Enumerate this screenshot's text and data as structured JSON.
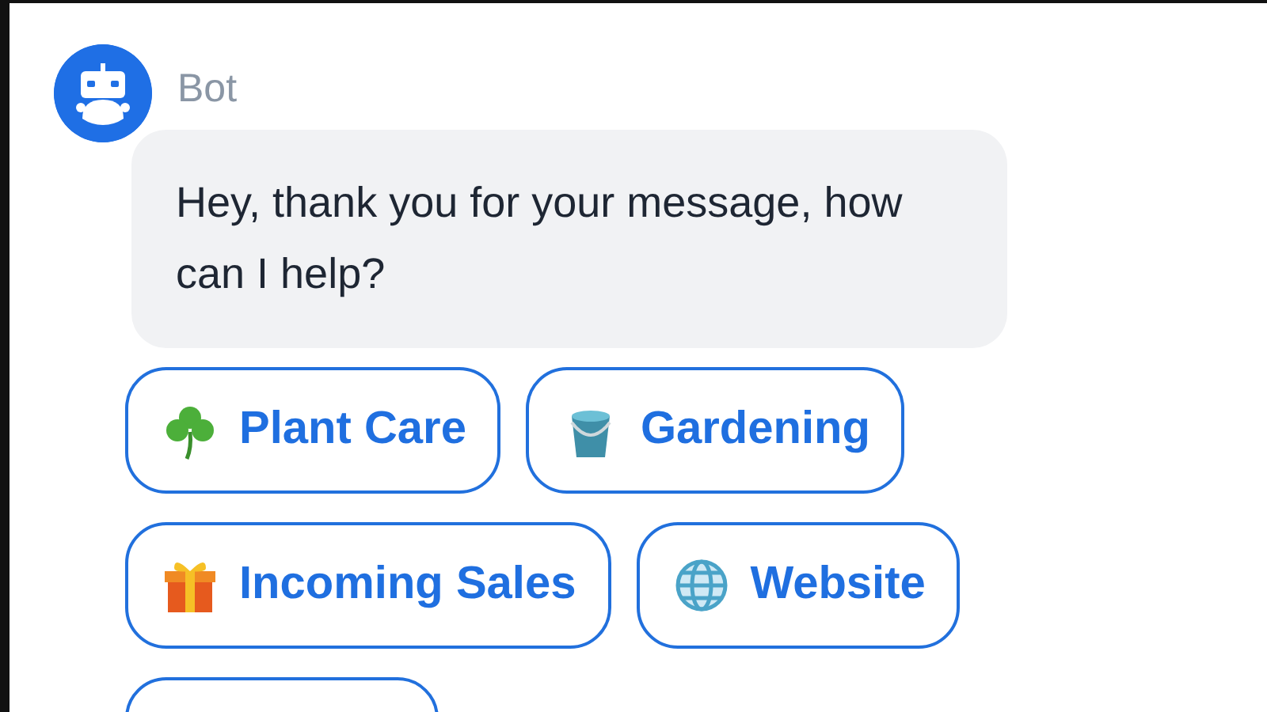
{
  "sender": {
    "name": "Bot"
  },
  "message": {
    "text": "Hey, thank you for your message, how can I help?"
  },
  "quick_replies": [
    {
      "kind": "clover",
      "label": "Plant Care"
    },
    {
      "kind": "bucket",
      "label": "Gardening"
    },
    {
      "kind": "gift",
      "label": "Incoming Sales"
    },
    {
      "kind": "globe",
      "label": "Website"
    },
    {
      "kind": "hidden"
    }
  ]
}
